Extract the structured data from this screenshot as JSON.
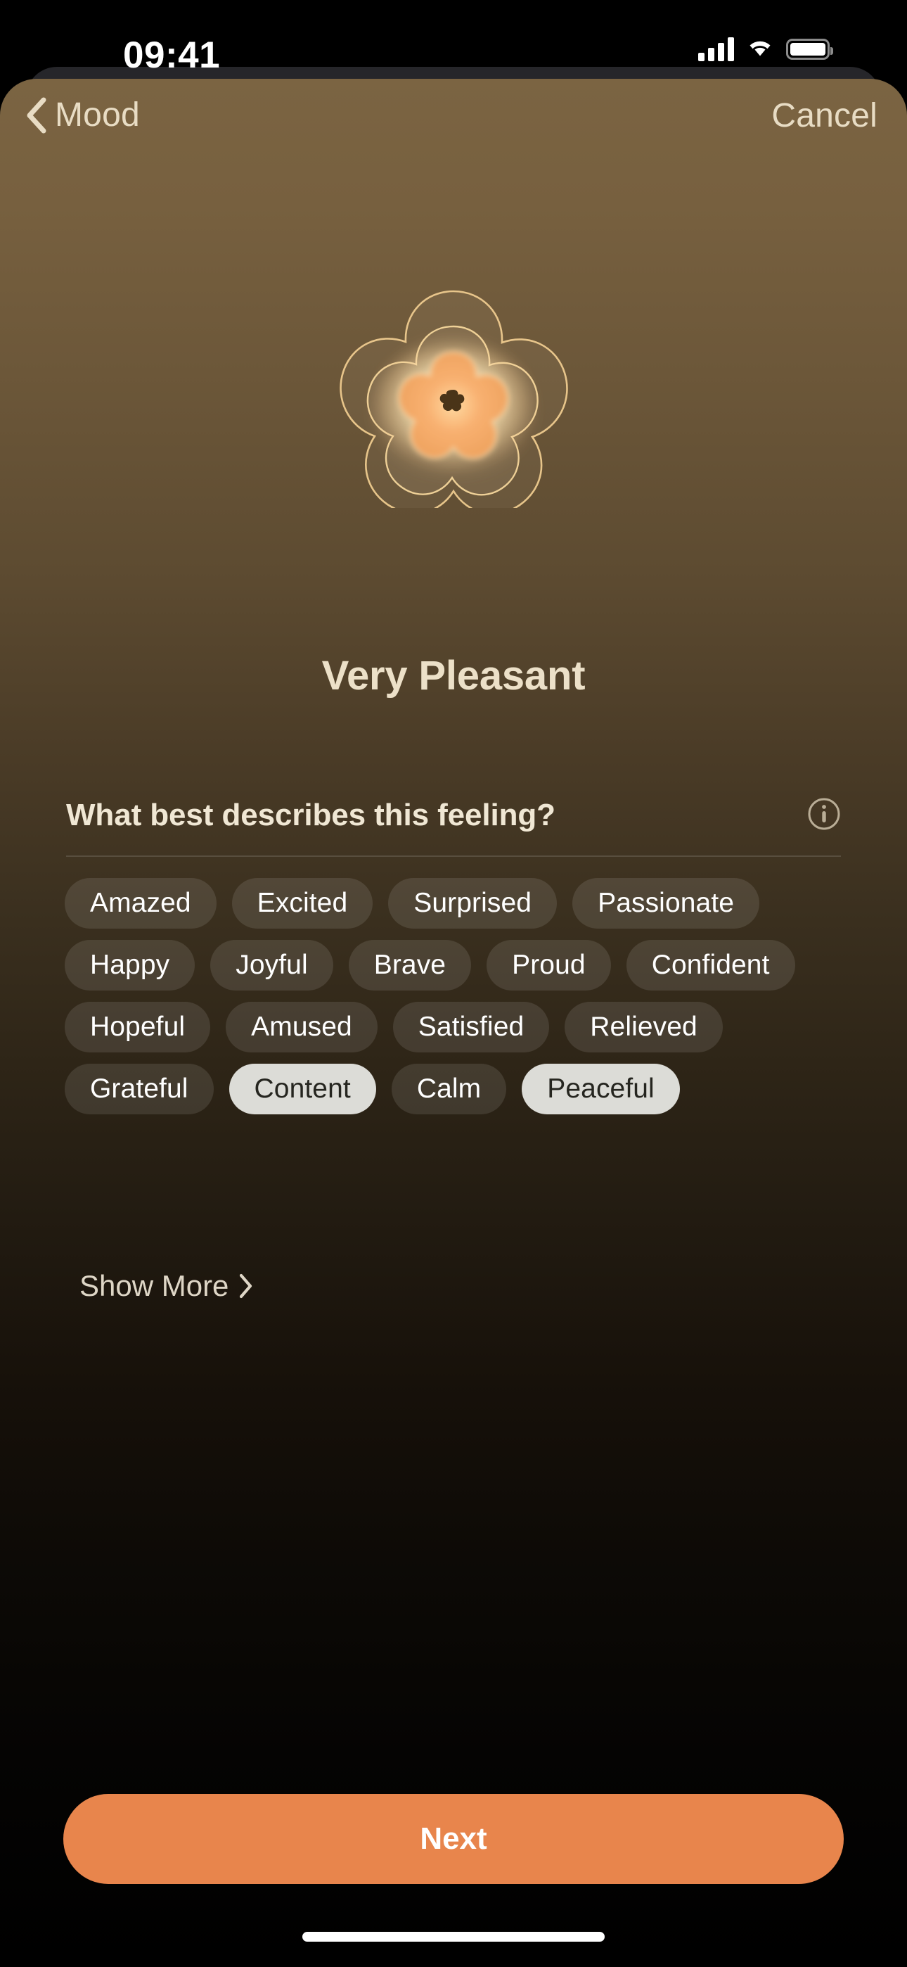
{
  "status_bar": {
    "time": "09:41",
    "cellular_icon": "cellular-signal-icon",
    "wifi_icon": "wifi-icon",
    "battery_icon": "battery-icon"
  },
  "nav": {
    "back_icon": "chevron-left-icon",
    "back_label": "Mood",
    "cancel_label": "Cancel"
  },
  "mood": {
    "icon": "flower-mood-icon",
    "title": "Very Pleasant"
  },
  "question": {
    "text": "What best describes this feeling?",
    "info_icon": "info-circle-icon"
  },
  "chips": {
    "rows": [
      [
        {
          "label": "Amazed",
          "selected": false
        },
        {
          "label": "Excited",
          "selected": false
        },
        {
          "label": "Surprised",
          "selected": false
        },
        {
          "label": "Passionate",
          "selected": false
        }
      ],
      [
        {
          "label": "Happy",
          "selected": false
        },
        {
          "label": "Joyful",
          "selected": false
        },
        {
          "label": "Brave",
          "selected": false
        },
        {
          "label": "Proud",
          "selected": false
        },
        {
          "label": "Confident",
          "selected": false
        }
      ],
      [
        {
          "label": "Hopeful",
          "selected": false
        },
        {
          "label": "Amused",
          "selected": false
        },
        {
          "label": "Satisfied",
          "selected": false
        },
        {
          "label": "Relieved",
          "selected": false
        }
      ],
      [
        {
          "label": "Grateful",
          "selected": false
        },
        {
          "label": "Content",
          "selected": true
        },
        {
          "label": "Calm",
          "selected": false
        },
        {
          "label": "Peaceful",
          "selected": true
        }
      ]
    ]
  },
  "show_more": {
    "label": "Show More",
    "chevron_icon": "chevron-right-icon"
  },
  "footer": {
    "next_label": "Next"
  },
  "colors": {
    "accent": "#E8854C",
    "sheet_top": "#7B6442",
    "sheet_bottom": "#000000",
    "chip_unselected_text": "#FFFFFF",
    "chip_selected_bg": "#DCDCD7",
    "chip_selected_text": "#25251F",
    "nav_text": "#E8DCC4",
    "title_text": "#ECE0C8"
  }
}
